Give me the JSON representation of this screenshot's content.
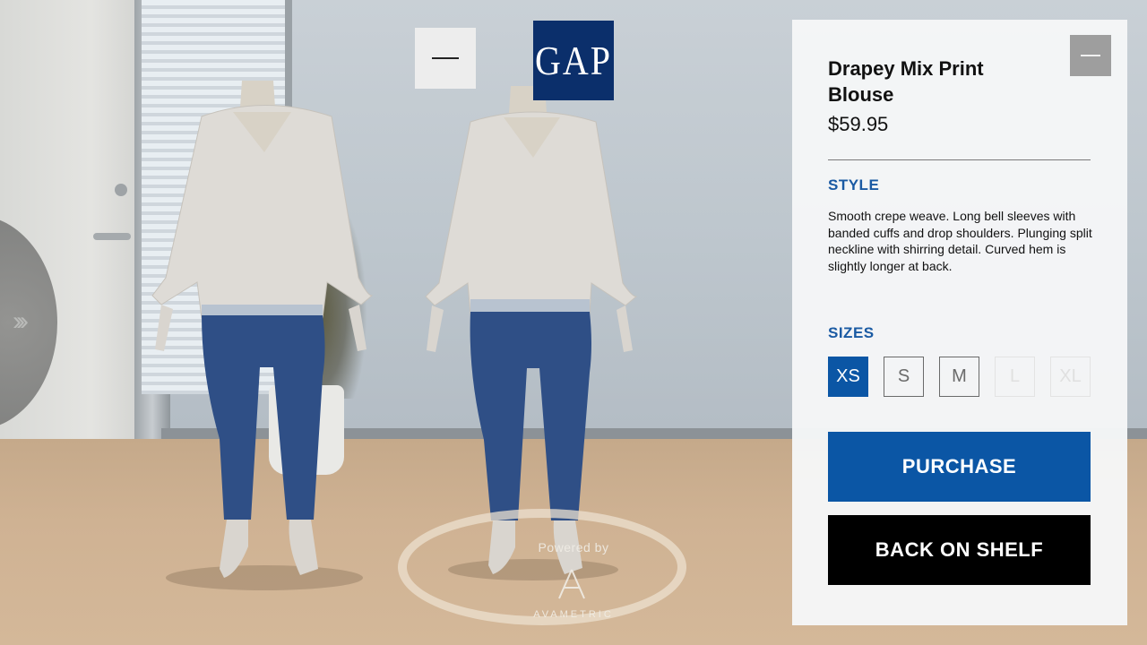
{
  "top_controls": {
    "brand_logo_text": "GAP"
  },
  "product": {
    "title": "Drapey Mix Print Blouse",
    "price": "$59.95",
    "style_heading": "STYLE",
    "description": "Smooth crepe weave. Long bell sleeves with banded cuffs and drop shoulders. Plunging split neckline with shirring detail. Curved hem is slightly longer at back.",
    "sizes_heading": "SIZES",
    "sizes": [
      {
        "label": "XS",
        "state": "selected"
      },
      {
        "label": "S",
        "state": "available"
      },
      {
        "label": "M",
        "state": "available"
      },
      {
        "label": "L",
        "state": "unavailable"
      },
      {
        "label": "XL",
        "state": "unavailable"
      }
    ],
    "purchase_label": "PURCHASE",
    "back_label": "BACK ON SHELF"
  },
  "platform": {
    "powered_by": "Powered by",
    "brand": "AVAMETRIC"
  },
  "colors": {
    "accent_blue": "#0b56a5",
    "gap_navy": "#0b2f6b",
    "back_button": "#000000"
  }
}
